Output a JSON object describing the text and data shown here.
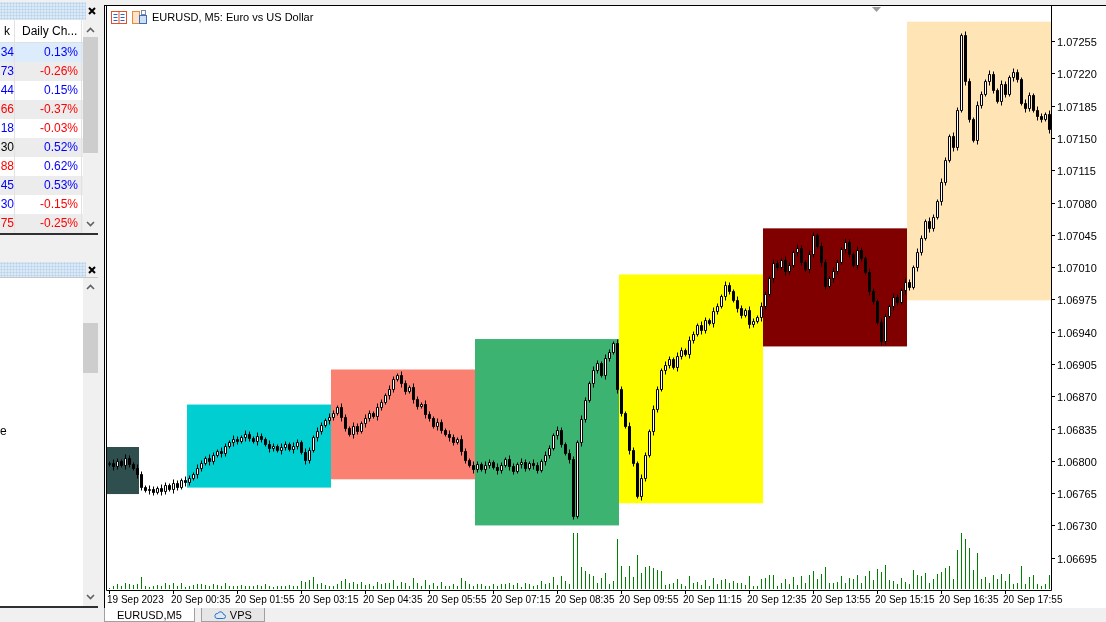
{
  "market_watch": {
    "columns": [
      "k",
      "Daily Ch..."
    ],
    "rows": [
      {
        "selected": true,
        "cells": [
          {
            "text": "34",
            "color": "#0000ff"
          },
          {
            "text": "0.13%",
            "color": "#0000ff"
          }
        ]
      },
      {
        "selected": false,
        "cells": [
          {
            "text": "73",
            "color": "#0000ff"
          },
          {
            "text": "-0.26%",
            "color": "#ff0000"
          }
        ]
      },
      {
        "selected": false,
        "cells": [
          {
            "text": "44",
            "color": "#0000ff"
          },
          {
            "text": "0.15%",
            "color": "#0000ff"
          }
        ]
      },
      {
        "selected": false,
        "cells": [
          {
            "text": "66",
            "color": "#ff0000"
          },
          {
            "text": "-0.37%",
            "color": "#ff0000"
          }
        ]
      },
      {
        "selected": false,
        "cells": [
          {
            "text": "18",
            "color": "#0000ff"
          },
          {
            "text": "-0.03%",
            "color": "#ff0000"
          }
        ]
      },
      {
        "selected": false,
        "cells": [
          {
            "text": "30",
            "color": "#000000"
          },
          {
            "text": "0.52%",
            "color": "#0000ff"
          }
        ]
      },
      {
        "selected": false,
        "cells": [
          {
            "text": "88",
            "color": "#ff0000"
          },
          {
            "text": "0.62%",
            "color": "#0000ff"
          }
        ]
      },
      {
        "selected": false,
        "cells": [
          {
            "text": "45",
            "color": "#0000ff"
          },
          {
            "text": "0.53%",
            "color": "#0000ff"
          }
        ]
      },
      {
        "selected": false,
        "cells": [
          {
            "text": "30",
            "color": "#0000ff"
          },
          {
            "text": "-0.15%",
            "color": "#ff0000"
          }
        ]
      },
      {
        "selected": false,
        "cells": [
          {
            "text": "75",
            "color": "#ff0000"
          },
          {
            "text": "-0.25%",
            "color": "#ff0000"
          }
        ]
      }
    ]
  },
  "navigator": {
    "items": [
      {
        "label": "e"
      }
    ]
  },
  "chart": {
    "title": "EURUSD, M5: Euro vs US Dollar",
    "session_boxes": [
      {
        "color": "#2f4f4f"
      },
      {
        "color": "#00ced1"
      },
      {
        "color": "#fa8072"
      },
      {
        "color": "#3cb371"
      },
      {
        "color": "#ffff00"
      },
      {
        "color": "#800000"
      },
      {
        "color": "#ffe4b5"
      }
    ],
    "price_axis_labels": [
      "1.07255",
      "1.07220",
      "1.07185",
      "1.07150",
      "1.07115",
      "1.07080",
      "1.07045",
      "1.07010",
      "1.06975",
      "1.06940",
      "1.06905",
      "1.06870",
      "1.06835",
      "1.06800",
      "1.06765",
      "1.06730",
      "1.06695"
    ],
    "time_axis_labels": [
      "19 Sep 2023",
      "20 Sep 00:35",
      "20 Sep 01:55",
      "20 Sep 03:15",
      "20 Sep 04:35",
      "20 Sep 05:55",
      "20 Sep 07:15",
      "20 Sep 08:35",
      "20 Sep 09:55",
      "20 Sep 11:15",
      "20 Sep 12:35",
      "20 Sep 13:55",
      "20 Sep 15:15",
      "20 Sep 16:35",
      "20 Sep 17:55"
    ]
  },
  "tabs": [
    {
      "label": "EURUSD,M5",
      "kind": "chart",
      "selected": true
    },
    {
      "label": "VPS",
      "kind": "service",
      "selected": false
    }
  ]
}
